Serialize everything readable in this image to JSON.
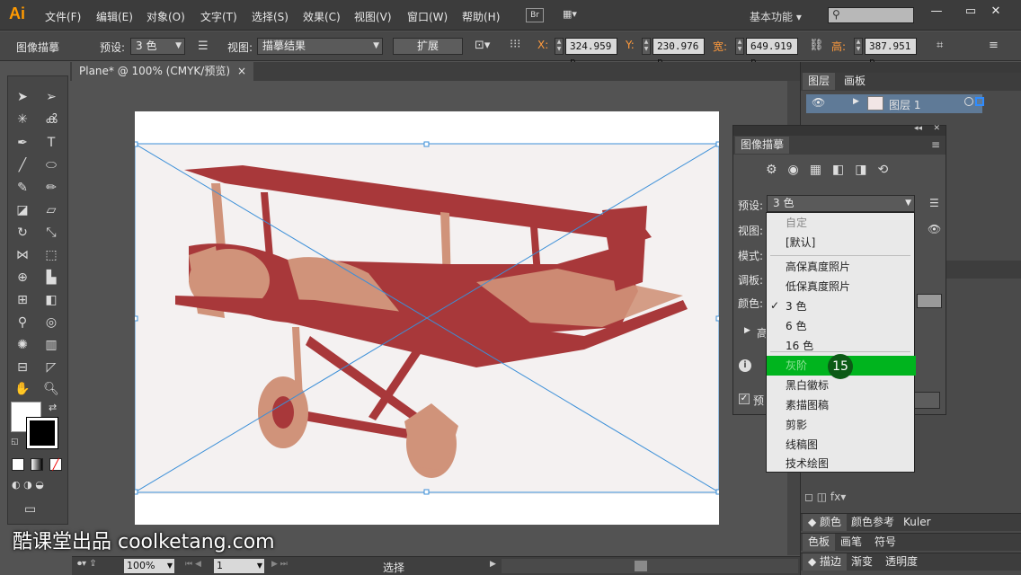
{
  "app": {
    "logo": "Ai",
    "br": "Br",
    "workspace": "基本功能"
  },
  "menu": [
    "文件(F)",
    "编辑(E)",
    "对象(O)",
    "文字(T)",
    "选择(S)",
    "效果(C)",
    "视图(V)",
    "窗口(W)",
    "帮助(H)"
  ],
  "window_controls": {
    "minimize": "—",
    "restore": "▭",
    "close": "✕"
  },
  "control": {
    "title": "图像描摹",
    "preset_label": "预设:",
    "preset_value": "3 色",
    "view_label": "视图:",
    "view_value": "描摹结果",
    "expand_button": "扩展",
    "x_label": "X:",
    "x_value": "324.959 p",
    "y_label": "Y:",
    "y_value": "230.976 p",
    "w_label": "宽:",
    "w_value": "649.919 p",
    "h_label": "高:",
    "h_value": "387.951 p"
  },
  "document": {
    "tab_label": "Plane* @ 100% (CMYK/预览)",
    "tab_close": "×"
  },
  "layers_panel": {
    "tabs": [
      "图层",
      "画板"
    ],
    "layer_name": "图层 1"
  },
  "trace_panel": {
    "title": "图像描摹",
    "preset_label": "预设:",
    "preset_value": "3 色",
    "view_label": "视图:",
    "mode_label": "模式:",
    "palette_label": "调板:",
    "colors_label": "颜色:",
    "advanced_label": "高",
    "preview_label": "预"
  },
  "preset_options": [
    {
      "label": "自定",
      "dim": true
    },
    {
      "label": "[默认]",
      "dim": false
    },
    {
      "label": "高保真度照片",
      "dim": false
    },
    {
      "label": "低保真度照片",
      "dim": false
    },
    {
      "label": "3 色",
      "dim": false,
      "checked": true
    },
    {
      "label": "6 色",
      "dim": false
    },
    {
      "label": "16 色",
      "dim": false
    },
    {
      "label": "灰阶",
      "dim": false,
      "highlighted": true
    },
    {
      "label": "黑白徽标",
      "dim": false
    },
    {
      "label": "素描图稿",
      "dim": false
    },
    {
      "label": "剪影",
      "dim": false
    },
    {
      "label": "线稿图",
      "dim": false
    },
    {
      "label": "技术绘图",
      "dim": false
    }
  ],
  "step_badge": "15",
  "lower_panels": {
    "color_tabs": [
      "颜色",
      "颜色参考",
      "Kuler"
    ],
    "swatch_tabs": [
      "色板",
      "画笔",
      "符号"
    ],
    "stroke_tabs": [
      "描边",
      "渐变",
      "透明度"
    ]
  },
  "status": {
    "zoom": "100%",
    "page": "1",
    "tool": "选择"
  },
  "watermark": "酷课堂出品 coolketang.com",
  "colors": {
    "accent": "#ff9a00",
    "highlight": "#00b41e",
    "plane_dark": "#a8383a",
    "plane_light": "#d0937a"
  }
}
